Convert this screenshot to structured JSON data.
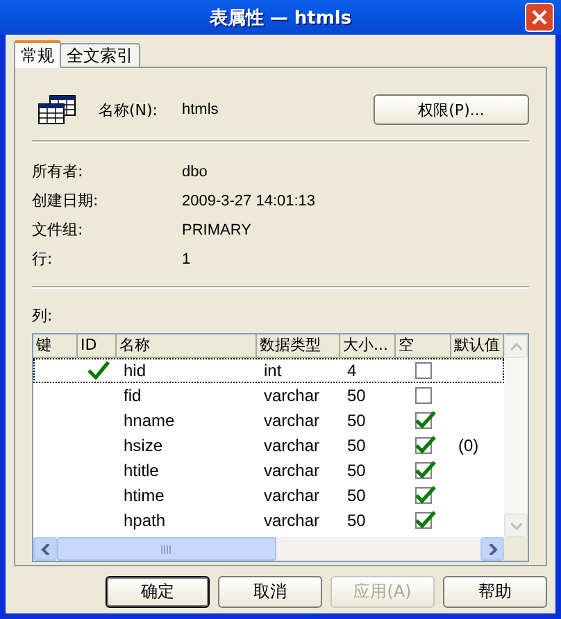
{
  "window": {
    "title": "表属性 — htmls"
  },
  "tabs": [
    {
      "label": "常规",
      "selected": true
    },
    {
      "label": "全文索引",
      "selected": false
    }
  ],
  "name": {
    "label": "名称(N):",
    "value": "htmls"
  },
  "permissions_button": "权限(P)...",
  "properties": [
    {
      "label": "所有者:",
      "value": "dbo"
    },
    {
      "label": "创建日期:",
      "value": "2009-3-27 14:01:13"
    },
    {
      "label": "文件组:",
      "value": "PRIMARY"
    },
    {
      "label": "行:",
      "value": "1"
    }
  ],
  "columns_label": "列:",
  "table": {
    "columns": [
      "键",
      "ID",
      "名称",
      "数据类型",
      "大小...",
      "空",
      "默认值"
    ],
    "rows": [
      {
        "id": true,
        "name": "hid",
        "type": "int",
        "size": "4",
        "nullable": false,
        "selected": true
      },
      {
        "id": false,
        "name": "fid",
        "type": "varchar",
        "size": "50",
        "nullable": false,
        "selected": false
      },
      {
        "id": false,
        "name": "hname",
        "type": "varchar",
        "size": "50",
        "nullable": true,
        "selected": false
      },
      {
        "id": false,
        "name": "hsize",
        "type": "varchar",
        "size": "50",
        "nullable": true,
        "default": "(0)",
        "selected": false
      },
      {
        "id": false,
        "name": "htitle",
        "type": "varchar",
        "size": "50",
        "nullable": true,
        "selected": false
      },
      {
        "id": false,
        "name": "htime",
        "type": "varchar",
        "size": "50",
        "nullable": true,
        "selected": false
      },
      {
        "id": false,
        "name": "hpath",
        "type": "varchar",
        "size": "50",
        "nullable": true,
        "selected": false
      }
    ]
  },
  "buttons": [
    {
      "label": "确定",
      "default": true,
      "disabled": false
    },
    {
      "label": "取消",
      "default": false,
      "disabled": false
    },
    {
      "label": "应用(A)",
      "default": false,
      "disabled": true
    },
    {
      "label": "帮助",
      "default": false,
      "disabled": false
    }
  ]
}
